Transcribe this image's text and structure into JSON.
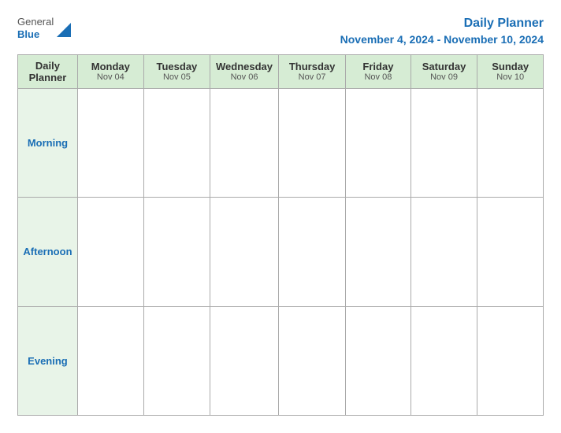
{
  "header": {
    "logo_general": "General",
    "logo_blue": "Blue",
    "title": "Daily Planner",
    "date_range": "November 4, 2024 - November 10, 2024"
  },
  "table": {
    "header_label": "Daily Planner",
    "days": [
      {
        "name": "Monday",
        "date": "Nov 04"
      },
      {
        "name": "Tuesday",
        "date": "Nov 05"
      },
      {
        "name": "Wednesday",
        "date": "Nov 06"
      },
      {
        "name": "Thursday",
        "date": "Nov 07"
      },
      {
        "name": "Friday",
        "date": "Nov 08"
      },
      {
        "name": "Saturday",
        "date": "Nov 09"
      },
      {
        "name": "Sunday",
        "date": "Nov 10"
      }
    ],
    "rows": [
      {
        "label": "Morning"
      },
      {
        "label": "Afternoon"
      },
      {
        "label": "Evening"
      }
    ]
  }
}
